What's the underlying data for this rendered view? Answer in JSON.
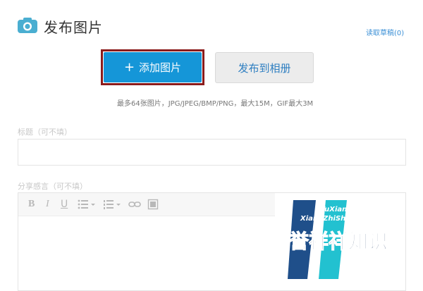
{
  "header": {
    "title": "发布图片",
    "icon": "camera-icon",
    "accent": "#4aaed1"
  },
  "draft_link": "读取草稿(0)",
  "buttons": {
    "add_label": "添加图片",
    "add_icon": "plus-icon",
    "publish_label": "发布到相册",
    "add_color": "#1596d8",
    "highlight_border": "#8b1b1b"
  },
  "hint": "最多64张图片，JPG/JPEG/BMP/PNG，最大15M，GIF最大3M",
  "title_field": {
    "label": "标题",
    "optional": "（可不填）",
    "value": ""
  },
  "content_field": {
    "label": "分享感言",
    "optional": "（可不填）",
    "value": ""
  },
  "toolbar": {
    "bold_label": "B",
    "italic_label": "I",
    "underline_label": "U",
    "icons": [
      "bold-icon",
      "italic-icon",
      "underline-icon",
      "bullet-list-icon",
      "numbered-list-icon",
      "link-icon",
      "image-icon"
    ]
  },
  "watermark": {
    "line1": "YuXiang",
    "line2": "XiangZhiShi",
    "chars": "誉祥祥知识"
  }
}
